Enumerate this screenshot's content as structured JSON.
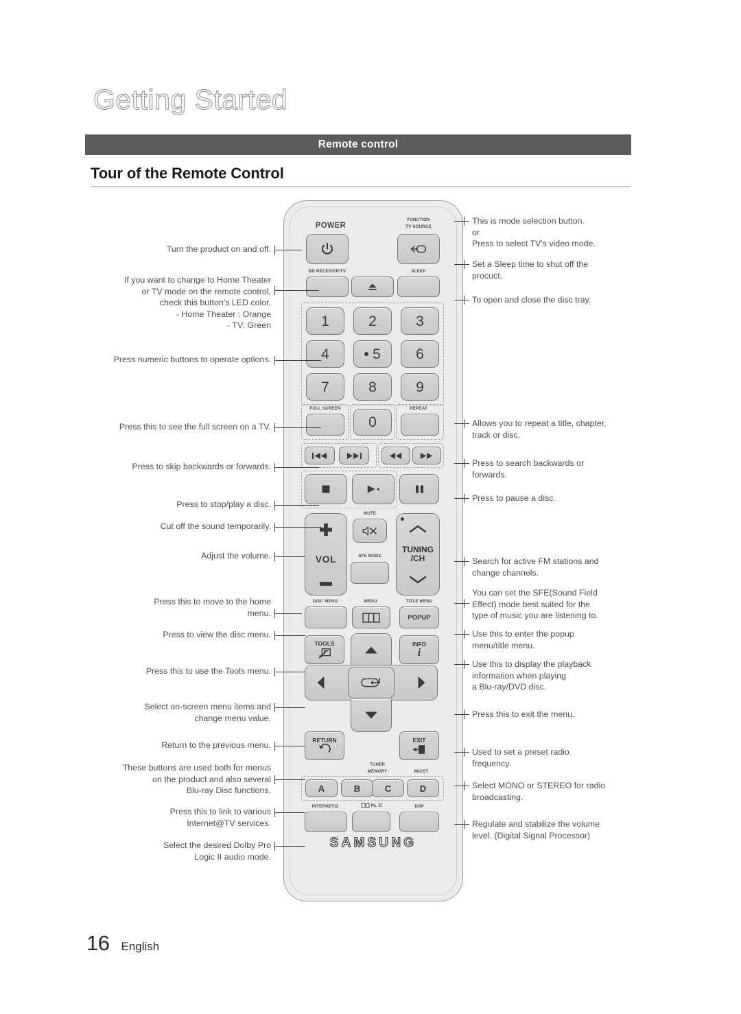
{
  "header": {
    "chapter": "Getting Started",
    "section_bar": "Remote control",
    "page_heading": "Tour of the Remote Control"
  },
  "footer": {
    "page_number": "16",
    "language": "English"
  },
  "remote": {
    "brand": "SAMSUNG",
    "keys": {
      "power_label": "POWER",
      "function_label_line1": "FUNCTION",
      "function_label_line2": "TV SOURCE",
      "bd_receiver_tv_label": "BD RECEIVER/TV",
      "sleep_label": "SLEEP",
      "eject_label": "",
      "numbers": [
        "1",
        "2",
        "3",
        "4",
        "5",
        "6",
        "7",
        "8",
        "9",
        "0"
      ],
      "full_screen_label": "FULL SCREEN",
      "repeat_label": "REPEAT",
      "mute_label": "MUTE",
      "vol_label": "VOL",
      "sfe_mode_label": "SFE MODE",
      "tuning_label_line1": "TUNING",
      "tuning_label_line2": "/CH",
      "disc_menu_label": "DISC MENU",
      "menu_label": "MENU",
      "title_menu_label": "TITLE MENU",
      "popup_label": "POPUP",
      "tools_label": "TOOLS",
      "info_label": "INFO",
      "return_label": "RETURN",
      "exit_label": "EXIT",
      "tuner_memory_label_line1": "TUNER",
      "tuner_memory_label_line2": "MEMORY",
      "most_label": "MO/ST",
      "color_buttons": [
        "A",
        "B",
        "C",
        "D"
      ],
      "internet_label": "INTERNET@",
      "dolby_label": "PL",
      "dolby_label_suffix": "II",
      "dsp_label": "DSP"
    }
  },
  "callouts": {
    "left": [
      {
        "id": "power",
        "text": "Turn the product on and off."
      },
      {
        "id": "bd-receiver-tv",
        "text": "If you want to change to Home Theater\nor TV mode on the remote control,\ncheck this button's LED color.\n- Home Theater : Orange\n- TV: Green"
      },
      {
        "id": "numeric",
        "text": "Press numeric buttons to operate options."
      },
      {
        "id": "full-screen",
        "text": "Press this to see the full screen on a TV."
      },
      {
        "id": "skip",
        "text": "Press to skip backwards or forwards."
      },
      {
        "id": "stop-play",
        "text": "Press to stop/play a disc."
      },
      {
        "id": "mute",
        "text": "Cut off the sound temporarily."
      },
      {
        "id": "volume",
        "text": "Adjust the volume."
      },
      {
        "id": "home-menu",
        "text": "Press this to move to the home\nmenu."
      },
      {
        "id": "disc-menu",
        "text": "Press to view the disc menu."
      },
      {
        "id": "tools",
        "text": "Press this to use the Tools menu."
      },
      {
        "id": "navigation",
        "text": "Select on-screen menu items and\nchange menu value."
      },
      {
        "id": "return",
        "text": "Return to the previous menu."
      },
      {
        "id": "color-buttons",
        "text": "These buttons are used both for menus\non the product and also several\nBlu-ray Disc functions."
      },
      {
        "id": "internet",
        "text": "Press this to link to various\nInternet@TV services."
      },
      {
        "id": "dolby",
        "text": "Select the desired Dolby Pro\nLogic II audio mode."
      }
    ],
    "right": [
      {
        "id": "function",
        "text": "This is mode selection button.\nor\nPress to select TV's video mode."
      },
      {
        "id": "sleep",
        "text": "Set a Sleep time to shut off the\nprocuct."
      },
      {
        "id": "eject",
        "text": "To open and close the disc tray."
      },
      {
        "id": "repeat",
        "text": "Allows you to repeat a title, chapter,\ntrack or disc."
      },
      {
        "id": "search",
        "text": "Press to search backwards or\nforwards."
      },
      {
        "id": "pause",
        "text": "Press to pause a disc."
      },
      {
        "id": "tuning",
        "text": "Search for active FM stations and\nchange channels."
      },
      {
        "id": "sfe-mode",
        "text": "You can set the SFE(Sound Field\nEffect) mode best suited for the\ntype of music you are listening to."
      },
      {
        "id": "popup",
        "text": "Use this to enter the popup\nmenu/title menu."
      },
      {
        "id": "info",
        "text": "Use this to display the playback\ninformation when playing\na Blu-ray/DVD disc."
      },
      {
        "id": "exit",
        "text": "Press this to exit the menu."
      },
      {
        "id": "tuner-memory",
        "text": "Used to set a preset radio\nfrequency."
      },
      {
        "id": "most",
        "text": "Select MONO or STEREO for radio\nbroadcasting."
      },
      {
        "id": "dsp",
        "text": "Regulate and stabilize the volume\nlevel. (Digital Signal Processor)"
      }
    ]
  },
  "colors": {
    "section_bar_bg": "#5b5b5d",
    "remote_body": "#ebebeb",
    "key_face": "#d0d0d2",
    "text": "#4d4d4f"
  }
}
